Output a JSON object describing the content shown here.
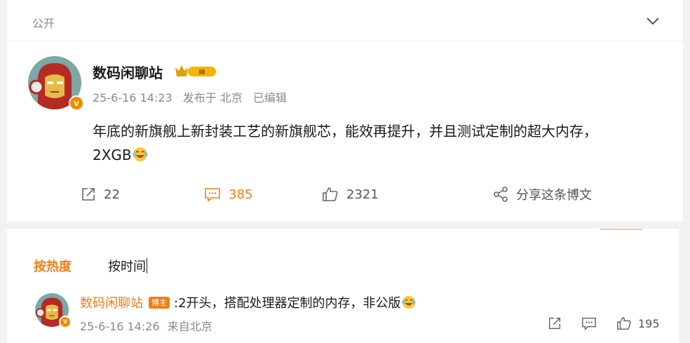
{
  "visibility": {
    "label": "公开"
  },
  "post": {
    "author": "数码闲聊站",
    "timestamp": "25-6-16 14:23",
    "location": "发布于 北京",
    "edited": "已编辑",
    "text_line1": "年底的新旗舰上新封装工艺的新旗舰芯，能效再提升，并且测试定制的超大内存，",
    "text_line2": "2XGB",
    "emoji_icon": "laugh-cry-emoji",
    "verified_badge": "v",
    "vip_badge": "III"
  },
  "actions": {
    "repost_count": "22",
    "comment_count": "385",
    "like_count": "2321",
    "share_label": "分享这条博文"
  },
  "comments_sort": {
    "hot_label": "按热度",
    "time_label": "按时间"
  },
  "comment": {
    "author": "数码闲聊站",
    "author_badge": "博主",
    "text": ":2开头，搭配处理器定制的内存，非公版",
    "timestamp": "25-6-16 14:26",
    "source": "来自北京",
    "like_count": "195"
  },
  "colors": {
    "accent": "#f07e15",
    "muted_text": "#8a8a8a",
    "body_text": "#1a1a1a"
  }
}
